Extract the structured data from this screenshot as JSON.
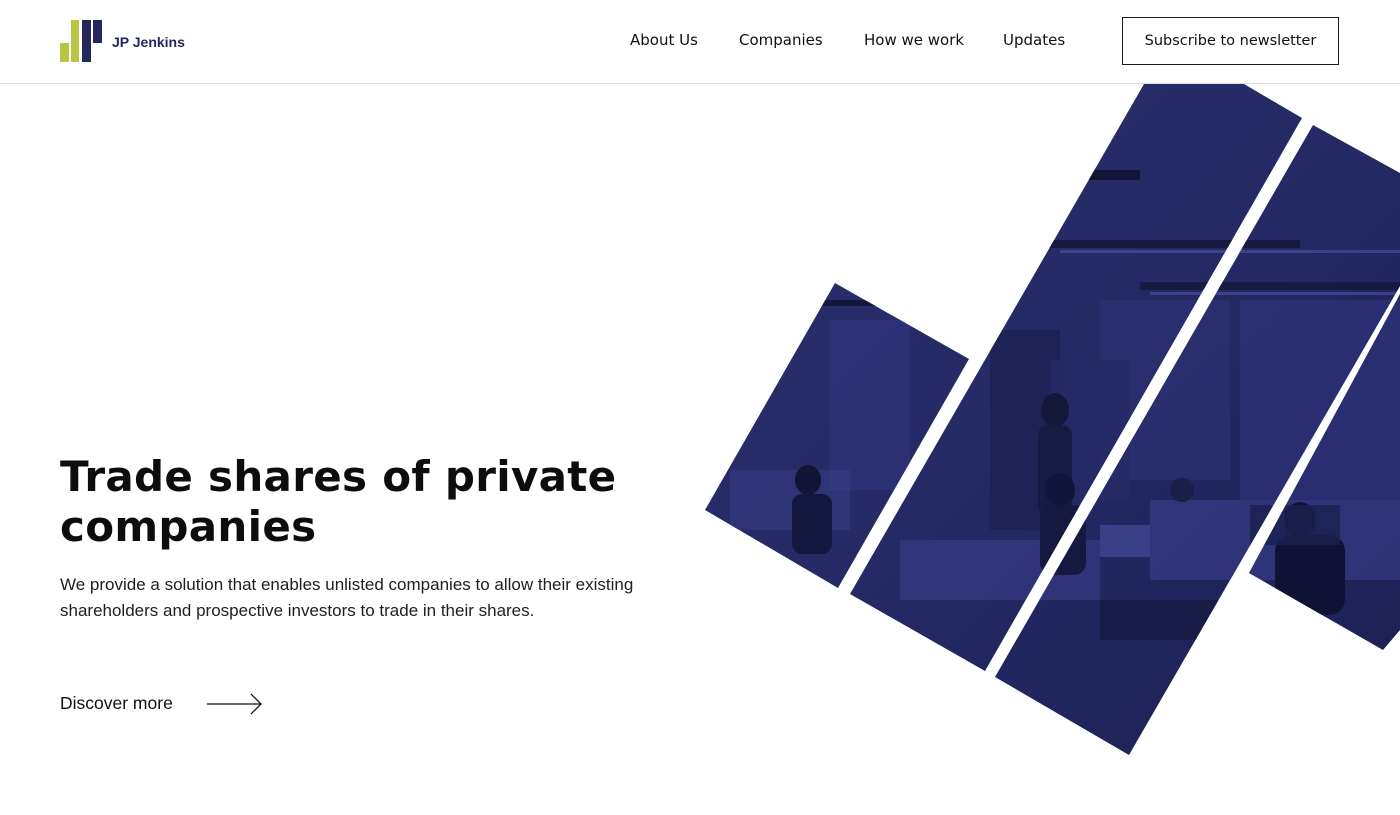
{
  "brand": {
    "name": "JP Jenkins",
    "colors": {
      "navy": "#23275e",
      "lime": "#b8c641",
      "hero_overlay": "#272b6e"
    }
  },
  "nav": {
    "items": [
      "About Us",
      "Companies",
      "How we work",
      "Updates"
    ],
    "cta_label": "Subscribe to newsletter"
  },
  "hero": {
    "title": "Trade shares of private companies",
    "description": "We provide a solution that enables unlisted companies to allow their existing shareholders and prospective investors to trade in their shares.",
    "link_label": "Discover more",
    "image_icon": "office-photo-slices"
  }
}
